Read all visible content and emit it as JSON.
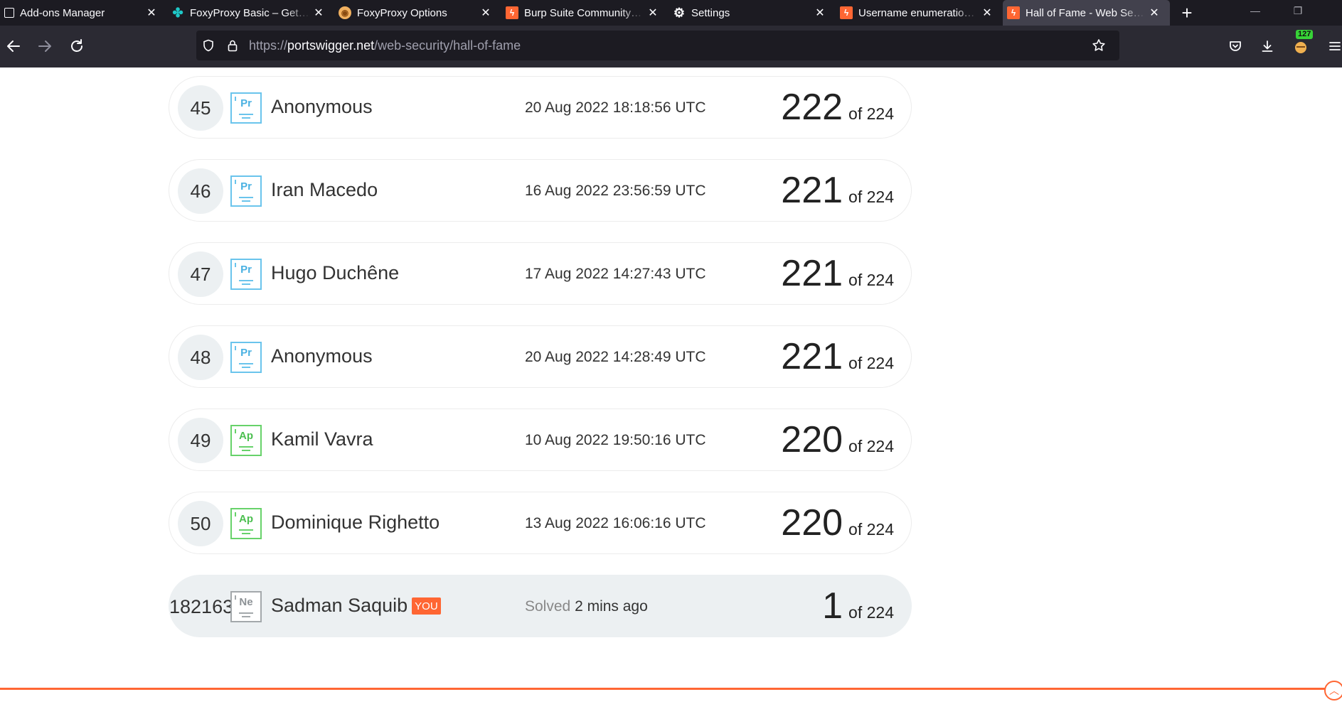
{
  "tabs": [
    {
      "title": "Add-ons Manager",
      "favicon": "puzzle-icon",
      "active": false
    },
    {
      "title": "FoxyProxy Basic – Get this Extension",
      "favicon": "foxyproxy-icon",
      "active": false
    },
    {
      "title": "FoxyProxy Options",
      "favicon": "foxyproxy-options-icon",
      "active": false
    },
    {
      "title": "Burp Suite Community Edition",
      "favicon": "burp-icon",
      "active": false
    },
    {
      "title": "Settings",
      "favicon": "gear-icon",
      "active": false
    },
    {
      "title": "Username enumeration via",
      "favicon": "burp-icon",
      "active": false
    },
    {
      "title": "Hall of Fame - Web Security Academy",
      "favicon": "burp-icon",
      "active": true
    }
  ],
  "navbar": {
    "url_prefix": "https://",
    "url_host": "portswigger.net",
    "url_path": "/web-security/hall-of-fame",
    "extension_badge": "127"
  },
  "rows": [
    {
      "rank": "45",
      "level": "Pr",
      "name": "Anonymous",
      "date": "20 Aug 2022 18:18:56 UTC",
      "solved": "222",
      "of": "of 224"
    },
    {
      "rank": "46",
      "level": "Pr",
      "name": "Iran Macedo",
      "date": "16 Aug 2022 23:56:59 UTC",
      "solved": "221",
      "of": "of 224"
    },
    {
      "rank": "47",
      "level": "Pr",
      "name": "Hugo Duchêne",
      "date": "17 Aug 2022 14:27:43 UTC",
      "solved": "221",
      "of": "of 224"
    },
    {
      "rank": "48",
      "level": "Pr",
      "name": "Anonymous",
      "date": "20 Aug 2022 14:28:49 UTC",
      "solved": "221",
      "of": "of 224"
    },
    {
      "rank": "49",
      "level": "Ap",
      "name": "Kamil Vavra",
      "date": "10 Aug 2022 19:50:16 UTC",
      "solved": "220",
      "of": "of 224"
    },
    {
      "rank": "50",
      "level": "Ap",
      "name": "Dominique Righetto",
      "date": "13 Aug 2022 16:06:16 UTC",
      "solved": "220",
      "of": "of 224"
    }
  ],
  "you_row": {
    "rank": "182163",
    "level": "Ne",
    "name": "Sadman Saquib",
    "badge": "YOU",
    "date_prefix": "Solved",
    "date": "2 mins ago",
    "solved": "1",
    "of": "of 224"
  },
  "colors": {
    "accent": "#ff6633",
    "level_practitioner": "#6ac4ec",
    "level_apprentice": "#67d26a",
    "level_newbie": "#a3a8ab"
  }
}
